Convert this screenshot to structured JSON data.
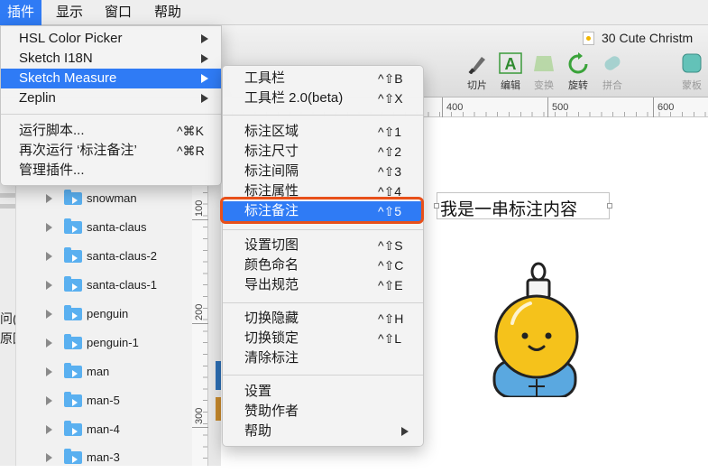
{
  "menubar": {
    "items": [
      "插件",
      "显示",
      "窗口",
      "帮助"
    ],
    "active_index": 0
  },
  "document": {
    "title": "30 Cute Christm"
  },
  "toolbar": {
    "tools": [
      {
        "label": "切片",
        "icon": "knife-icon",
        "enabled": true
      },
      {
        "label": "编辑",
        "icon": "edit-vector-icon",
        "enabled": true
      },
      {
        "label": "变换",
        "icon": "transform-icon",
        "enabled": false
      },
      {
        "label": "旋转",
        "icon": "rotate-icon",
        "enabled": true
      },
      {
        "label": "拼合",
        "icon": "flatten-icon",
        "enabled": false
      },
      {
        "label": "蒙板",
        "icon": "mask-icon",
        "enabled": false
      }
    ]
  },
  "ruler": {
    "top_ticks": [
      "400",
      "500",
      "600"
    ],
    "left_ticks": [
      "100",
      "200",
      "300"
    ]
  },
  "layers": [
    "snowman",
    "santa-claus",
    "santa-claus-2",
    "santa-claus-1",
    "penguin",
    "penguin-1",
    "man",
    "man-5",
    "man-4",
    "man-3"
  ],
  "left_edge_text": [
    "问(",
    "原因"
  ],
  "canvas": {
    "annotation_text": "我是一串标注内容"
  },
  "plugins_menu": {
    "items": [
      {
        "label": "HSL Color Picker",
        "submenu": true
      },
      {
        "label": "Sketch I18N",
        "submenu": true
      },
      {
        "label": "Sketch Measure",
        "submenu": true,
        "highlighted": true
      },
      {
        "label": "Zeplin",
        "submenu": true
      },
      {
        "label": "运行脚本...",
        "shortcut": "^⌘K"
      },
      {
        "label": "再次运行 ‘标注备注’",
        "shortcut": "^⌘R"
      },
      {
        "label": "管理插件..."
      }
    ]
  },
  "measure_menu": {
    "items": [
      {
        "label": "工具栏",
        "shortcut": "^⇧B"
      },
      {
        "label": "工具栏 2.0(beta)",
        "shortcut": "^⇧X"
      },
      {
        "label": "标注区域",
        "shortcut": "^⇧1"
      },
      {
        "label": "标注尺寸",
        "shortcut": "^⇧2"
      },
      {
        "label": "标注间隔",
        "shortcut": "^⇧3"
      },
      {
        "label": "标注属性",
        "shortcut": "^⇧4"
      },
      {
        "label": "标注备注",
        "shortcut": "^⇧5",
        "highlighted": true
      },
      {
        "label": "设置切图",
        "shortcut": "^⇧S"
      },
      {
        "label": "颜色命名",
        "shortcut": "^⇧C"
      },
      {
        "label": "导出规范",
        "shortcut": "^⇧E"
      },
      {
        "label": "切换隐藏",
        "shortcut": "^⇧H"
      },
      {
        "label": "切换锁定",
        "shortcut": "^⇧L"
      },
      {
        "label": "清除标注"
      },
      {
        "label": "设置"
      },
      {
        "label": "赞助作者"
      },
      {
        "label": "帮助",
        "submenu": true
      }
    ]
  },
  "colors": {
    "highlight": "#2f7bf5",
    "callout_ring": "#e8501a",
    "folder": "#5ab0f0"
  }
}
